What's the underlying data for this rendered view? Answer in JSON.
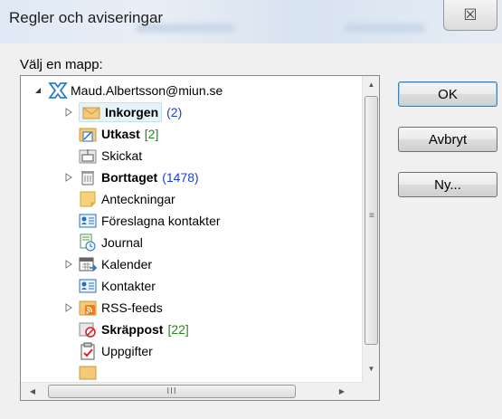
{
  "window": {
    "title": "Regler och aviseringar"
  },
  "title_bar": {
    "close_glyph": "☒"
  },
  "dialog": {
    "folder_label": "Välj en mapp:",
    "buttons": {
      "ok": "OK",
      "cancel": "Avbryt",
      "new": "Ny..."
    }
  },
  "tree": {
    "account": {
      "label": "Maud.Albertsson@miun.se",
      "icon": "exchange-account-icon"
    },
    "items": [
      {
        "label": "Inkorgen",
        "count": "(2)",
        "icon": "inbox-icon"
      },
      {
        "label": "Utkast",
        "count": "[2]",
        "icon": "drafts-icon"
      },
      {
        "label": "Skickat",
        "count": "",
        "icon": "sent-icon"
      },
      {
        "label": "Borttaget",
        "count": "(1478)",
        "icon": "deleted-icon"
      },
      {
        "label": "Anteckningar",
        "count": "",
        "icon": "notes-icon"
      },
      {
        "label": "Föreslagna kontakter",
        "count": "",
        "icon": "suggested-contacts-icon"
      },
      {
        "label": "Journal",
        "count": "",
        "icon": "journal-icon"
      },
      {
        "label": "Kalender",
        "count": "",
        "icon": "calendar-icon"
      },
      {
        "label": "Kontakter",
        "count": "",
        "icon": "contacts-icon"
      },
      {
        "label": "RSS-feeds",
        "count": "",
        "icon": "rss-icon"
      },
      {
        "label": "Skräppost",
        "count": "[22]",
        "icon": "junk-icon"
      },
      {
        "label": "Uppgifter",
        "count": "",
        "icon": "tasks-icon"
      }
    ]
  },
  "scrollbars": {
    "thumb_grip": "≡",
    "h_grip": "III"
  }
}
